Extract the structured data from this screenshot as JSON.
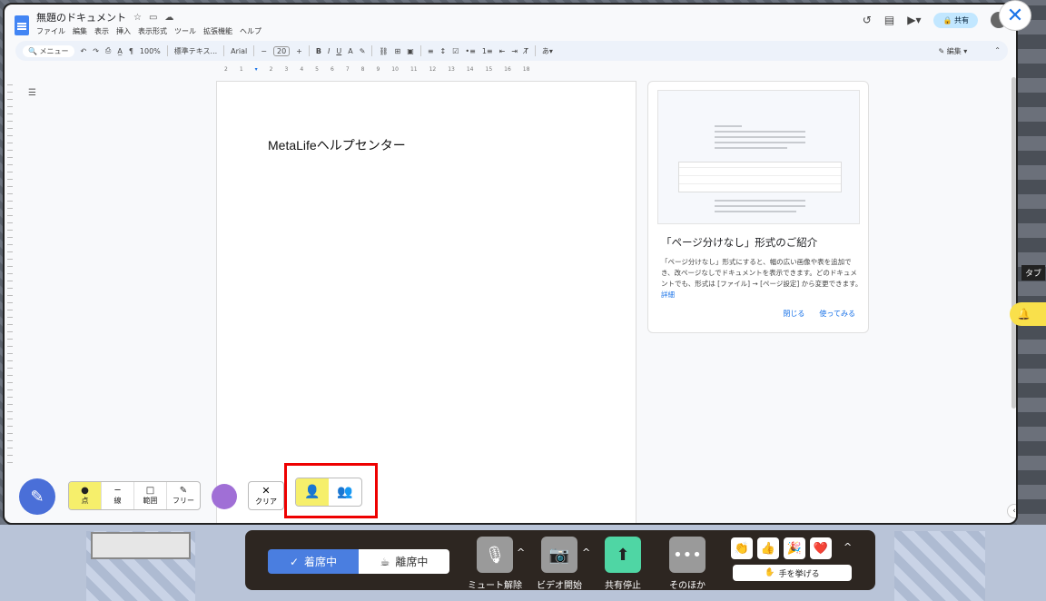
{
  "docs": {
    "title": "無題のドキュメント",
    "menu": [
      "ファイル",
      "編集",
      "表示",
      "挿入",
      "表示形式",
      "ツール",
      "拡張機能",
      "ヘルプ"
    ],
    "share_label": "共有",
    "toolbar": {
      "search_placeholder": "メニュー",
      "zoom": "100%",
      "style": "標準テキス...",
      "font": "Arial",
      "font_size": "20",
      "mode": "編集"
    },
    "ruler_ticks": [
      "2",
      "1",
      "1",
      "2",
      "3",
      "4",
      "5",
      "6",
      "7",
      "8",
      "9",
      "10",
      "11",
      "12",
      "13",
      "14",
      "15",
      "16",
      "18"
    ],
    "body_text": "MetaLifeヘルプセンター"
  },
  "card": {
    "title": "「ページ分けなし」形式のご紹介",
    "body": "「ページ分けなし」形式にすると、幅の広い画像や表を追加でき、改ページなしでドキュメントを表示できます。どのドキュメントでも、形式は [ファイル] → [ページ設定] から変更できます。",
    "detail_link": "詳細",
    "close_label": "閉じる",
    "try_label": "使ってみる"
  },
  "annotate": {
    "tools": [
      {
        "glyph": "●",
        "label": "点",
        "active": true
      },
      {
        "glyph": "─",
        "label": "線",
        "active": false
      },
      {
        "glyph": "□",
        "label": "範囲",
        "active": false
      },
      {
        "glyph": "✎",
        "label": "フリー",
        "active": false
      }
    ],
    "clear_glyph": "✕",
    "clear_label": "クリア",
    "pen_color": "#a06fd6"
  },
  "side_peek": {
    "tab_label": "タブ"
  },
  "bottom": {
    "present_label": "着席中",
    "away_label": "離席中",
    "mute_label": "ミュート解除",
    "video_label": "ビデオ開始",
    "share_stop_label": "共有停止",
    "more_label": "そのほか",
    "raise_hand_label": "手を挙げる",
    "reactions": [
      "👏",
      "👍",
      "🎉",
      "❤️"
    ]
  },
  "colors": {
    "accent_blue": "#4a7ee0",
    "highlight_yellow": "#f6ef6b",
    "annotation_red": "#e00000",
    "share_green": "#4fd6a4"
  }
}
